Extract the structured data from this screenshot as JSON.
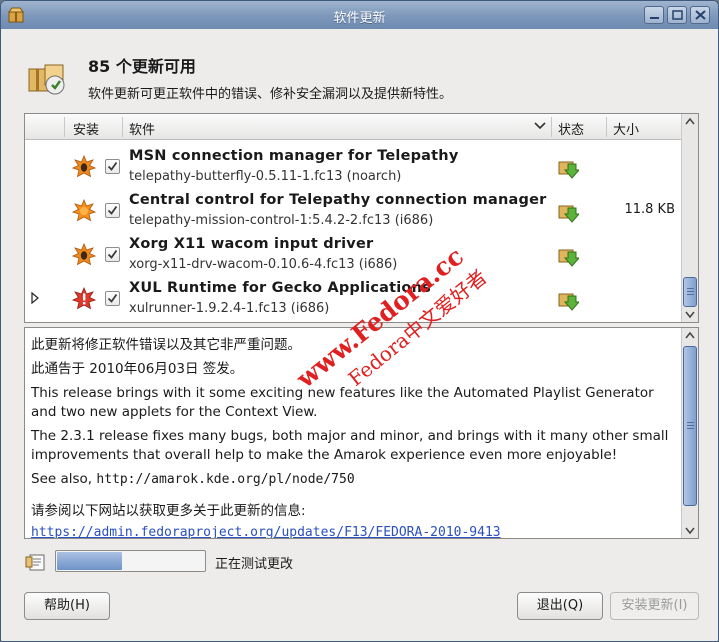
{
  "window": {
    "title": "软件更新"
  },
  "header": {
    "title": "85 个更新可用",
    "subtitle": "软件更新可更正软件中的错误、修补安全漏洞以及提供新特性。"
  },
  "list": {
    "columns": {
      "install": "安装",
      "software": "软件",
      "status": "状态",
      "size": "大小"
    },
    "rows": [
      {
        "name": "MSN connection manager for Telepathy",
        "package": "telepathy-butterfly-0.5.11-1.fc13 (noarch)",
        "severity_icon": "bug-fix-icon",
        "checked": true,
        "size": ""
      },
      {
        "name": "Central control for Telepathy connection manager",
        "package": "telepathy-mission-control-1:5.4.2-2.fc13 (i686)",
        "severity_icon": "enhancement-icon",
        "checked": true,
        "size": "11.8 KB"
      },
      {
        "name": "Xorg X11 wacom input driver",
        "package": "xorg-x11-drv-wacom-0.10.6-4.fc13 (i686)",
        "severity_icon": "bug-fix-icon",
        "checked": true,
        "size": ""
      },
      {
        "name": "XUL Runtime for Gecko Applications",
        "package": "xulrunner-1.9.2.4-1.fc13 (i686)",
        "severity_icon": "security-update-icon",
        "checked": true,
        "size": ""
      }
    ]
  },
  "details": {
    "line1": "此更新将修正软件错误以及其它非严重问题。",
    "line2": "此通告于 2010年06月03日 签发。",
    "para1": "This release brings with it some exciting new features like the Automated Playlist Generator and two new applets for the Context View.",
    "para2": "The 2.3.1 release fixes many bugs, both major and minor, and brings with it many other small improvements that overall help to make the Amarok experience even more enjoyable!",
    "see_also_prefix": "See also, ",
    "see_also_url": "http://amarok.kde.org/pl/node/750",
    "more_info": "请参阅以下网站以获取更多关于此更新的信息:",
    "more_info_link": "https://admin.fedoraproject.org/updates/F13/FEDORA-2010-9413"
  },
  "progress": {
    "label": "正在测试更改",
    "fraction": 0.45
  },
  "buttons": {
    "help": "帮助(H)",
    "quit": "退出(Q)",
    "install": "安装更新(I)"
  },
  "watermark": {
    "line1": "www.Fedora.cc",
    "line2": "Fedora中文爱好者"
  },
  "colors": {
    "titlebar": "#7d97ba",
    "link": "#2a4fbf",
    "watermark": "#e02020",
    "progress": "#6f93c8"
  }
}
